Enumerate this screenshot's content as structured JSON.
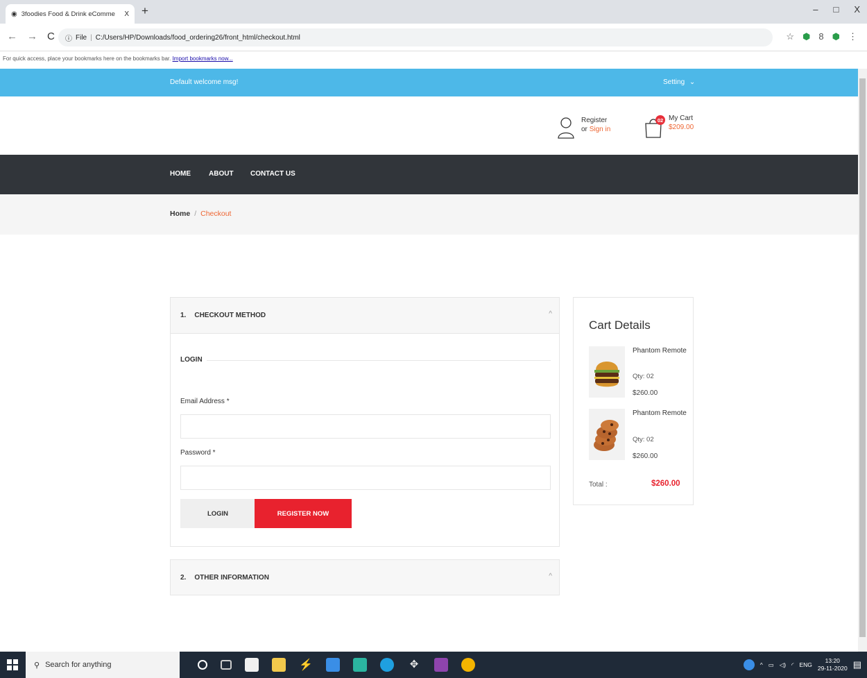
{
  "browser": {
    "tab_title": "3foodies Food & Drink eComme",
    "tab_close": "X",
    "new_tab": "+",
    "url_prefix": "File",
    "url": "C:/Users/HP/Downloads/food_ordering26/front_html/checkout.html",
    "bookmarks_msg": "For quick access, place your bookmarks here on the bookmarks bar.",
    "bookmarks_link": "Import bookmarks now...",
    "window_controls": [
      "–",
      "□",
      "X"
    ]
  },
  "topbar": {
    "welcome": "Default welcome msg!",
    "setting": "Setting",
    "bg_color": "#4db8e8"
  },
  "header": {
    "register": "Register",
    "or": "or",
    "sign_in": "Sign in",
    "cart_count": "02",
    "cart_label": "My Cart",
    "cart_total": "$209.00"
  },
  "nav": {
    "items": [
      "HOME",
      "ABOUT",
      "CONTACT US"
    ]
  },
  "breadcrumb": {
    "home": "Home",
    "sep": "/",
    "current": "Checkout"
  },
  "checkout": {
    "step1_num": "1.",
    "step1_title": "CHECKOUT METHOD",
    "login_heading": "LOGIN",
    "email_label": "Email Address *",
    "password_label": "Password *",
    "login_button": "LOGIN",
    "register_button": "REGISTER NOW",
    "step2_num": "2.",
    "step2_title": "OTHER INFORMATION",
    "accent_color": "#e8222e"
  },
  "cart_details": {
    "title": "Cart Details",
    "items": [
      {
        "name": "Phantom Remote",
        "qty": "Qty: 02",
        "price": "$260.00",
        "image": "burger"
      },
      {
        "name": "Phantom Remote",
        "qty": "Qty: 02",
        "price": "$260.00",
        "image": "cookies"
      }
    ],
    "total_label": "Total :",
    "total_value": "$260.00"
  },
  "taskbar": {
    "search_placeholder": "Search for anything",
    "lang": "ENG",
    "time": "13:20",
    "date": "29-11-2020"
  }
}
